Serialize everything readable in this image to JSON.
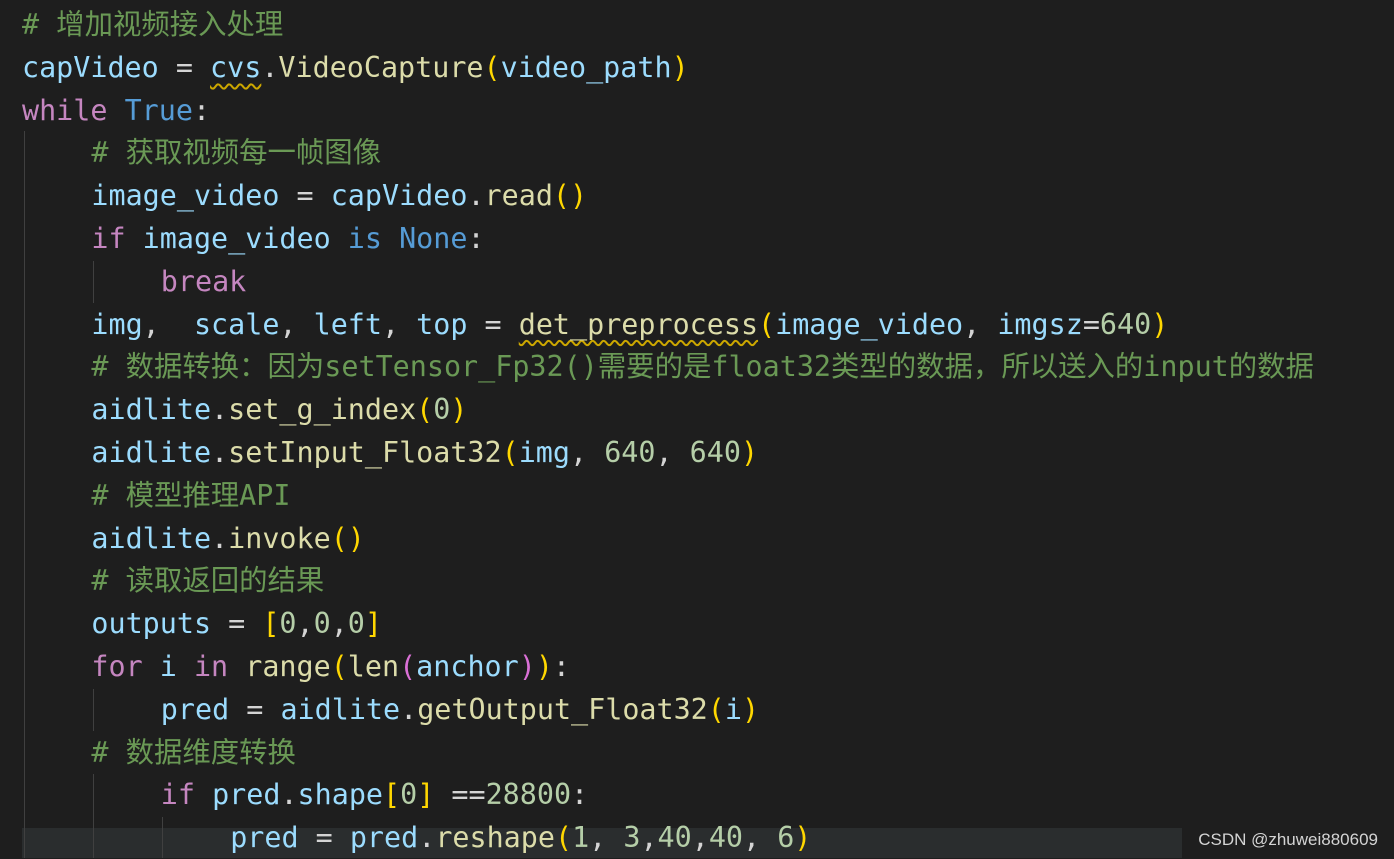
{
  "editor": {
    "lines": [
      {
        "indent": 0,
        "tokens": [
          {
            "t": "# 增加视频接入处理",
            "c": "cm"
          }
        ]
      },
      {
        "indent": 0,
        "tokens": [
          {
            "t": "capVideo",
            "c": "vr"
          },
          {
            "t": " = ",
            "c": "tx"
          },
          {
            "t": "cvs",
            "c": "vr",
            "sq": true
          },
          {
            "t": ".",
            "c": "tx"
          },
          {
            "t": "VideoCapture",
            "c": "fn"
          },
          {
            "t": "(",
            "c": "b1"
          },
          {
            "t": "video_path",
            "c": "vr"
          },
          {
            "t": ")",
            "c": "b1"
          }
        ]
      },
      {
        "indent": 0,
        "tokens": [
          {
            "t": "while",
            "c": "kw"
          },
          {
            "t": " ",
            "c": "tx"
          },
          {
            "t": "True",
            "c": "kb"
          },
          {
            "t": ":",
            "c": "tx"
          }
        ]
      },
      {
        "indent": 1,
        "tokens": [
          {
            "t": "# 获取视频每一帧图像",
            "c": "cm"
          }
        ]
      },
      {
        "indent": 1,
        "tokens": [
          {
            "t": "image_video",
            "c": "vr"
          },
          {
            "t": " = ",
            "c": "tx"
          },
          {
            "t": "capVideo",
            "c": "vr"
          },
          {
            "t": ".",
            "c": "tx"
          },
          {
            "t": "read",
            "c": "fn"
          },
          {
            "t": "()",
            "c": "b1"
          }
        ]
      },
      {
        "indent": 1,
        "tokens": [
          {
            "t": "if",
            "c": "kw"
          },
          {
            "t": " ",
            "c": "tx"
          },
          {
            "t": "image_video",
            "c": "vr"
          },
          {
            "t": " ",
            "c": "tx"
          },
          {
            "t": "is",
            "c": "kb"
          },
          {
            "t": " ",
            "c": "tx"
          },
          {
            "t": "None",
            "c": "kb"
          },
          {
            "t": ":",
            "c": "tx"
          }
        ]
      },
      {
        "indent": 2,
        "tokens": [
          {
            "t": "break",
            "c": "kw"
          }
        ]
      },
      {
        "indent": 1,
        "tokens": [
          {
            "t": "img",
            "c": "vr"
          },
          {
            "t": ",  ",
            "c": "tx"
          },
          {
            "t": "scale",
            "c": "vr"
          },
          {
            "t": ", ",
            "c": "tx"
          },
          {
            "t": "left",
            "c": "vr"
          },
          {
            "t": ", ",
            "c": "tx"
          },
          {
            "t": "top",
            "c": "vr"
          },
          {
            "t": " = ",
            "c": "tx"
          },
          {
            "t": "det_preprocess",
            "c": "fn",
            "sq": true
          },
          {
            "t": "(",
            "c": "b1"
          },
          {
            "t": "image_video",
            "c": "vr"
          },
          {
            "t": ", ",
            "c": "tx"
          },
          {
            "t": "imgsz",
            "c": "vr"
          },
          {
            "t": "=",
            "c": "tx"
          },
          {
            "t": "640",
            "c": "nm"
          },
          {
            "t": ")",
            "c": "b1"
          }
        ]
      },
      {
        "indent": 1,
        "tokens": [
          {
            "t": "# 数据转换：因为setTensor_Fp32()需要的是float32类型的数据，所以送入的input的数据",
            "c": "cm"
          }
        ]
      },
      {
        "indent": 1,
        "tokens": [
          {
            "t": "aidlite",
            "c": "vr"
          },
          {
            "t": ".",
            "c": "tx"
          },
          {
            "t": "set_g_index",
            "c": "fn"
          },
          {
            "t": "(",
            "c": "b1"
          },
          {
            "t": "0",
            "c": "nm"
          },
          {
            "t": ")",
            "c": "b1"
          }
        ]
      },
      {
        "indent": 1,
        "tokens": [
          {
            "t": "aidlite",
            "c": "vr"
          },
          {
            "t": ".",
            "c": "tx"
          },
          {
            "t": "setInput_Float32",
            "c": "fn"
          },
          {
            "t": "(",
            "c": "b1"
          },
          {
            "t": "img",
            "c": "vr"
          },
          {
            "t": ", ",
            "c": "tx"
          },
          {
            "t": "640",
            "c": "nm"
          },
          {
            "t": ", ",
            "c": "tx"
          },
          {
            "t": "640",
            "c": "nm"
          },
          {
            "t": ")",
            "c": "b1"
          }
        ]
      },
      {
        "indent": 1,
        "tokens": [
          {
            "t": "# 模型推理API",
            "c": "cm"
          }
        ]
      },
      {
        "indent": 1,
        "tokens": [
          {
            "t": "aidlite",
            "c": "vr"
          },
          {
            "t": ".",
            "c": "tx"
          },
          {
            "t": "invoke",
            "c": "fn"
          },
          {
            "t": "()",
            "c": "b1"
          }
        ]
      },
      {
        "indent": 1,
        "tokens": [
          {
            "t": "# 读取返回的结果",
            "c": "cm"
          }
        ]
      },
      {
        "indent": 1,
        "tokens": [
          {
            "t": "outputs",
            "c": "vr"
          },
          {
            "t": " = ",
            "c": "tx"
          },
          {
            "t": "[",
            "c": "b1"
          },
          {
            "t": "0",
            "c": "nm"
          },
          {
            "t": ",",
            "c": "tx"
          },
          {
            "t": "0",
            "c": "nm"
          },
          {
            "t": ",",
            "c": "tx"
          },
          {
            "t": "0",
            "c": "nm"
          },
          {
            "t": "]",
            "c": "b1"
          }
        ]
      },
      {
        "indent": 1,
        "tokens": [
          {
            "t": "for",
            "c": "kw"
          },
          {
            "t": " ",
            "c": "tx"
          },
          {
            "t": "i",
            "c": "vr"
          },
          {
            "t": " ",
            "c": "tx"
          },
          {
            "t": "in",
            "c": "kw"
          },
          {
            "t": " ",
            "c": "tx"
          },
          {
            "t": "range",
            "c": "fn"
          },
          {
            "t": "(",
            "c": "b1"
          },
          {
            "t": "len",
            "c": "fn"
          },
          {
            "t": "(",
            "c": "b2"
          },
          {
            "t": "anchor",
            "c": "vr"
          },
          {
            "t": ")",
            "c": "b2"
          },
          {
            "t": ")",
            "c": "b1"
          },
          {
            "t": ":",
            "c": "tx"
          }
        ]
      },
      {
        "indent": 2,
        "tokens": [
          {
            "t": "pred",
            "c": "vr"
          },
          {
            "t": " = ",
            "c": "tx"
          },
          {
            "t": "aidlite",
            "c": "vr"
          },
          {
            "t": ".",
            "c": "tx"
          },
          {
            "t": "getOutput_Float32",
            "c": "fn"
          },
          {
            "t": "(",
            "c": "b1"
          },
          {
            "t": "i",
            "c": "vr"
          },
          {
            "t": ")",
            "c": "b1"
          }
        ]
      },
      {
        "indent": 1,
        "tokens": [
          {
            "t": "# 数据维度转换",
            "c": "cm"
          }
        ]
      },
      {
        "indent": 2,
        "tokens": [
          {
            "t": "if",
            "c": "kw"
          },
          {
            "t": " ",
            "c": "tx"
          },
          {
            "t": "pred",
            "c": "vr"
          },
          {
            "t": ".",
            "c": "tx"
          },
          {
            "t": "shape",
            "c": "vr"
          },
          {
            "t": "[",
            "c": "b1"
          },
          {
            "t": "0",
            "c": "nm"
          },
          {
            "t": "]",
            "c": "b1"
          },
          {
            "t": " ==",
            "c": "tx"
          },
          {
            "t": "28800",
            "c": "nm"
          },
          {
            "t": ":",
            "c": "tx"
          }
        ]
      },
      {
        "indent": 3,
        "tokens": [
          {
            "t": "pred",
            "c": "vr"
          },
          {
            "t": " = ",
            "c": "tx"
          },
          {
            "t": "pred",
            "c": "vr"
          },
          {
            "t": ".",
            "c": "tx"
          },
          {
            "t": "reshape",
            "c": "fn"
          },
          {
            "t": "(",
            "c": "b1"
          },
          {
            "t": "1",
            "c": "nm"
          },
          {
            "t": ", ",
            "c": "tx"
          },
          {
            "t": "3",
            "c": "nm"
          },
          {
            "t": ",",
            "c": "tx"
          },
          {
            "t": "40",
            "c": "nm"
          },
          {
            "t": ",",
            "c": "tx"
          },
          {
            "t": "40",
            "c": "nm"
          },
          {
            "t": ", ",
            "c": "tx"
          },
          {
            "t": "6",
            "c": "nm"
          },
          {
            "t": ")",
            "c": "b1"
          }
        ]
      }
    ]
  },
  "watermark": "CSDN @zhuwei880609"
}
